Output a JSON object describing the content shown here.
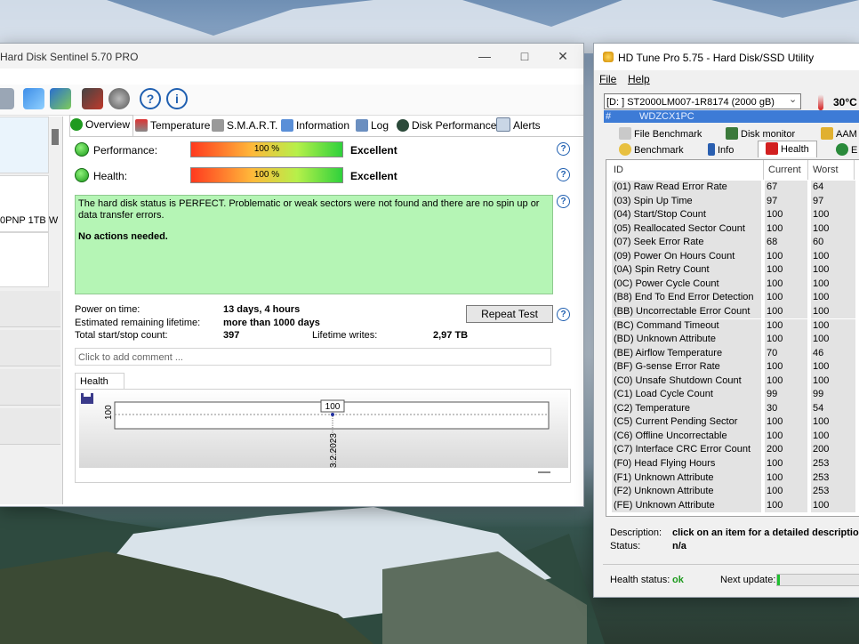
{
  "hds": {
    "title": "Hard Disk Sentinel 5.70 PRO",
    "disk_label": "0PNP 1TB W",
    "tabs": [
      {
        "label": "Overview",
        "icon": "overview-check-icon"
      },
      {
        "label": "Temperature",
        "icon": "thermometer-icon"
      },
      {
        "label": "S.M.A.R.T.",
        "icon": "smart-icon"
      },
      {
        "label": "Information",
        "icon": "information-icon"
      },
      {
        "label": "Log",
        "icon": "log-icon"
      },
      {
        "label": "Disk Performance",
        "icon": "disk-performance-icon"
      },
      {
        "label": "Alerts",
        "icon": "alerts-icon"
      }
    ],
    "performance": {
      "label": "Performance:",
      "percent": 100,
      "text": "100 %",
      "rating": "Excellent"
    },
    "health": {
      "label": "Health:",
      "percent": 100,
      "text": "100 %",
      "rating": "Excellent"
    },
    "status_text": "The hard disk status is PERFECT. Problematic or weak sectors were not found and there are no spin up or data transfer errors.",
    "actions_text": "No actions needed.",
    "power_on_label": "Power on time:",
    "power_on_value": "13 days, 4 hours",
    "lifetime_label": "Estimated remaining lifetime:",
    "lifetime_value": "more than 1000 days",
    "startstop_label": "Total start/stop count:",
    "startstop_value": "397",
    "writes_label": "Lifetime writes:",
    "writes_value": "2,97 TB",
    "repeat_test_label": "Repeat Test",
    "comment_placeholder": "Click to add comment ...",
    "graph_tab": "Health (%)",
    "chart_data": {
      "type": "line",
      "x": [
        "3.2.2023"
      ],
      "series": [
        {
          "values": [
            100
          ]
        }
      ],
      "ytick": "100",
      "point_label": "100"
    }
  },
  "hdt": {
    "title": "HD Tune Pro 5.75 - Hard Disk/SSD Utility",
    "menu_file": "File",
    "menu_help": "Help",
    "drive": "[D: ] ST2000LM007-1R8174 (2000 gB)",
    "temperature": "30°C",
    "serial_hash": "#",
    "serial": "WDZCX1PC",
    "tabs_row1": [
      "File Benchmark",
      "Disk monitor",
      "AAM"
    ],
    "tabs_row2": [
      "Benchmark",
      "Info",
      "Health",
      "E"
    ],
    "columns": {
      "id": "ID",
      "current": "Current",
      "worst": "Worst"
    },
    "rows": [
      {
        "id": "(01) Raw Read Error Rate",
        "current": "67",
        "worst": "64"
      },
      {
        "id": "(03) Spin Up Time",
        "current": "97",
        "worst": "97"
      },
      {
        "id": "(04) Start/Stop Count",
        "current": "100",
        "worst": "100"
      },
      {
        "id": "(05) Reallocated Sector Count",
        "current": "100",
        "worst": "100"
      },
      {
        "id": "(07) Seek Error Rate",
        "current": "68",
        "worst": "60"
      },
      {
        "id": "(09) Power On Hours Count",
        "current": "100",
        "worst": "100"
      },
      {
        "id": "(0A) Spin Retry Count",
        "current": "100",
        "worst": "100"
      },
      {
        "id": "(0C) Power Cycle Count",
        "current": "100",
        "worst": "100"
      },
      {
        "id": "(B8) End To End Error Detection",
        "current": "100",
        "worst": "100"
      },
      {
        "id": "(BB) Uncorrectable Error Count",
        "current": "100",
        "worst": "100"
      },
      {
        "id": "(BC) Command Timeout",
        "current": "100",
        "worst": "100"
      },
      {
        "id": "(BD) Unknown Attribute",
        "current": "100",
        "worst": "100"
      },
      {
        "id": "(BE) Airflow Temperature",
        "current": "70",
        "worst": "46"
      },
      {
        "id": "(BF) G-sense Error Rate",
        "current": "100",
        "worst": "100"
      },
      {
        "id": "(C0) Unsafe Shutdown Count",
        "current": "100",
        "worst": "100"
      },
      {
        "id": "(C1) Load Cycle Count",
        "current": "99",
        "worst": "99"
      },
      {
        "id": "(C2) Temperature",
        "current": "30",
        "worst": "54"
      },
      {
        "id": "(C5) Current Pending Sector",
        "current": "100",
        "worst": "100"
      },
      {
        "id": "(C6) Offline Uncorrectable",
        "current": "100",
        "worst": "100"
      },
      {
        "id": "(C7) Interface CRC Error Count",
        "current": "200",
        "worst": "200"
      },
      {
        "id": "(F0) Head Flying Hours",
        "current": "100",
        "worst": "253"
      },
      {
        "id": "(F1) Unknown Attribute",
        "current": "100",
        "worst": "253"
      },
      {
        "id": "(F2) Unknown Attribute",
        "current": "100",
        "worst": "253"
      },
      {
        "id": "(FE) Unknown Attribute",
        "current": "100",
        "worst": "100"
      }
    ],
    "description_label": "Description:",
    "description_value": "click on an item for a detailed description",
    "status_label": "Status:",
    "status_value": "n/a",
    "health_status_label": "Health status:",
    "health_status_value": "ok",
    "next_update_label": "Next update:"
  },
  "colors": {
    "accent": "#3d7bd6",
    "ok_green": "#1f9a1f",
    "status_bg": "#b5f5b5"
  }
}
